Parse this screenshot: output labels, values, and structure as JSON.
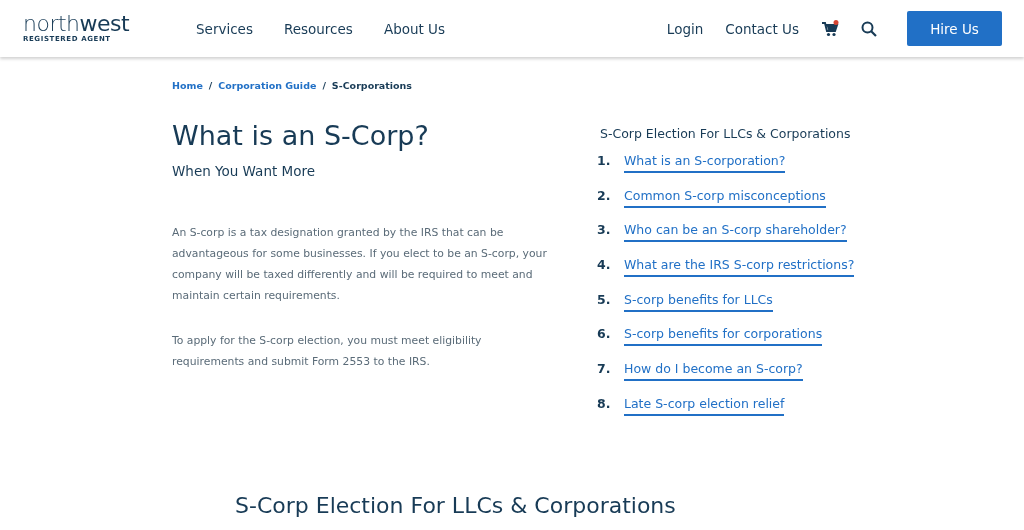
{
  "header": {
    "logo": {
      "wordmark": "north**west**",
      "tagline": "REGISTERED AGENT"
    },
    "nav": [
      "Services",
      "Resources",
      "About Us"
    ],
    "right_links": [
      "Login",
      "Contact Us"
    ],
    "cart": {
      "has_items": true
    },
    "cta": "Hire Us"
  },
  "breadcrumb": [
    {
      "label": "Home",
      "kind": "link"
    },
    {
      "label": "Corporation Guide",
      "kind": "link"
    },
    {
      "label": "S-Corporations",
      "kind": "current"
    }
  ],
  "breadcrumb_separator": "/",
  "intro": {
    "title": "What is an S-Corp?",
    "subtitle": "When You Want More",
    "paragraphs": [
      "An S-corp is a tax designation granted by the IRS that can be advantageous for some businesses. If you elect to be an S-corp, your company will be taxed differently and will be required to meet and maintain certain requirements.",
      "To apply for the S-corp election, you must meet eligibility requirements and submit Form 2553 to the IRS."
    ]
  },
  "toc": {
    "heading": "S-Corp Election For LLCs & Corporations",
    "items": [
      {
        "number": "1.",
        "label": "What is an S-corporation?"
      },
      {
        "number": "2.",
        "label": "Common S-corp misconceptions"
      },
      {
        "number": "3.",
        "label": "Who can be an S-corp shareholder?"
      },
      {
        "number": "4.",
        "label": "What are the IRS S-corp restrictions?"
      },
      {
        "number": "5.",
        "label": "S-corp benefits for LLCs"
      },
      {
        "number": "6.",
        "label": "S-corp benefits for corporations"
      },
      {
        "number": "7.",
        "label": "How do I become an S-corp?"
      },
      {
        "number": "8.",
        "label": "Late S-corp election relief"
      }
    ]
  },
  "section_heading": "S-Corp Election For LLCs & Corporations"
}
